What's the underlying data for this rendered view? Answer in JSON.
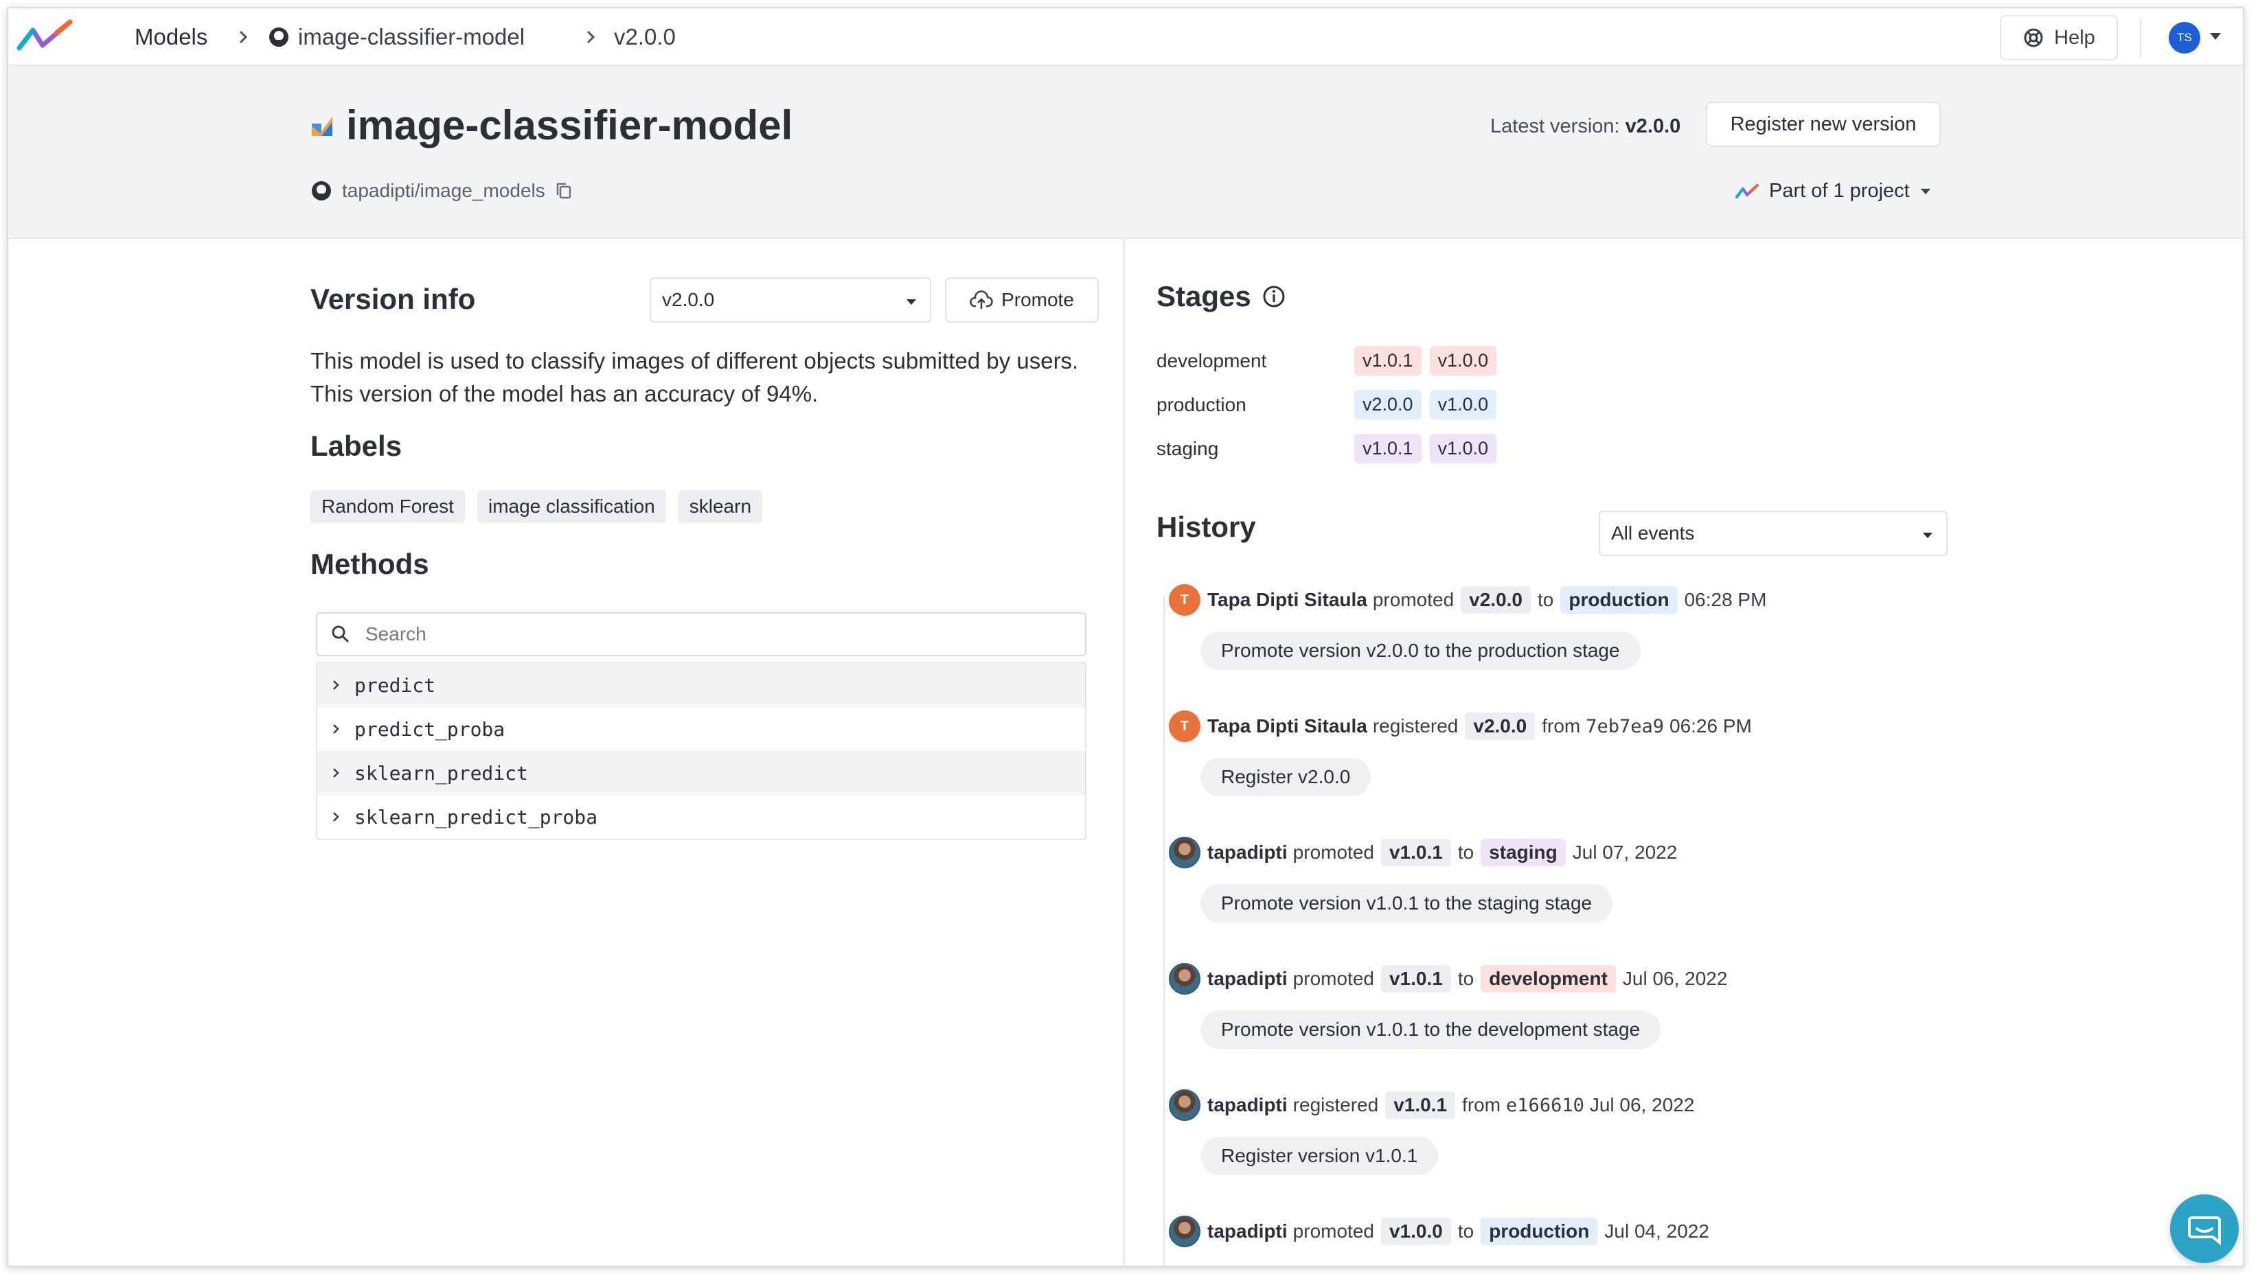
{
  "nav": {
    "breadcrumb_models": "Models",
    "breadcrumb_model": "image-classifier-model",
    "breadcrumb_version": "v2.0.0",
    "help_label": "Help",
    "user_initials": "TS"
  },
  "header": {
    "title": "image-classifier-model",
    "repo": "tapadipti/image_models",
    "latest_label": "Latest version:",
    "latest_value": "v2.0.0",
    "register_button": "Register new version",
    "part_of": "Part of 1 project"
  },
  "version_info": {
    "title": "Version info",
    "selected_version": "v2.0.0",
    "promote_button": "Promote",
    "description": "This model is used to classify images of different objects submitted by users. This version of the model has an accuracy of 94%."
  },
  "labels": {
    "title": "Labels",
    "items": [
      "Random Forest",
      "image classification",
      "sklearn"
    ]
  },
  "methods": {
    "title": "Methods",
    "search_placeholder": "Search",
    "items": [
      "predict",
      "predict_proba",
      "sklearn_predict",
      "sklearn_predict_proba"
    ]
  },
  "stages": {
    "title": "Stages",
    "rows": [
      {
        "name": "development",
        "versions": [
          "v1.0.1",
          "v1.0.0"
        ]
      },
      {
        "name": "production",
        "versions": [
          "v2.0.0",
          "v1.0.0"
        ]
      },
      {
        "name": "staging",
        "versions": [
          "v1.0.1",
          "v1.0.0"
        ]
      }
    ]
  },
  "history": {
    "title": "History",
    "filter": "All events",
    "events": [
      {
        "user": "Tapa Dipti Sitaula",
        "action": "promoted",
        "version": "v2.0.0",
        "connector": "to",
        "stage": "production",
        "time": "06:28 PM",
        "note": "Promote version v2.0.0 to the production stage"
      },
      {
        "user": "Tapa Dipti Sitaula",
        "action": "registered",
        "version": "v2.0.0",
        "connector": "from",
        "commit": "7eb7ea9",
        "time": "06:26 PM",
        "note": "Register v2.0.0"
      },
      {
        "user": "tapadipti",
        "action": "promoted",
        "version": "v1.0.1",
        "connector": "to",
        "stage": "staging",
        "time": "Jul 07, 2022",
        "note": "Promote version v1.0.1 to the staging stage"
      },
      {
        "user": "tapadipti",
        "action": "promoted",
        "version": "v1.0.1",
        "connector": "to",
        "stage": "development",
        "time": "Jul 06, 2022",
        "note": "Promote version v1.0.1 to the development stage"
      },
      {
        "user": "tapadipti",
        "action": "registered",
        "version": "v1.0.1",
        "connector": "from",
        "commit": "e166610",
        "time": "Jul 06, 2022",
        "note": "Register version v1.0.1"
      },
      {
        "user": "tapadipti",
        "action": "promoted",
        "version": "v1.0.0",
        "connector": "to",
        "stage": "production",
        "time": "Jul 04, 2022"
      }
    ]
  }
}
